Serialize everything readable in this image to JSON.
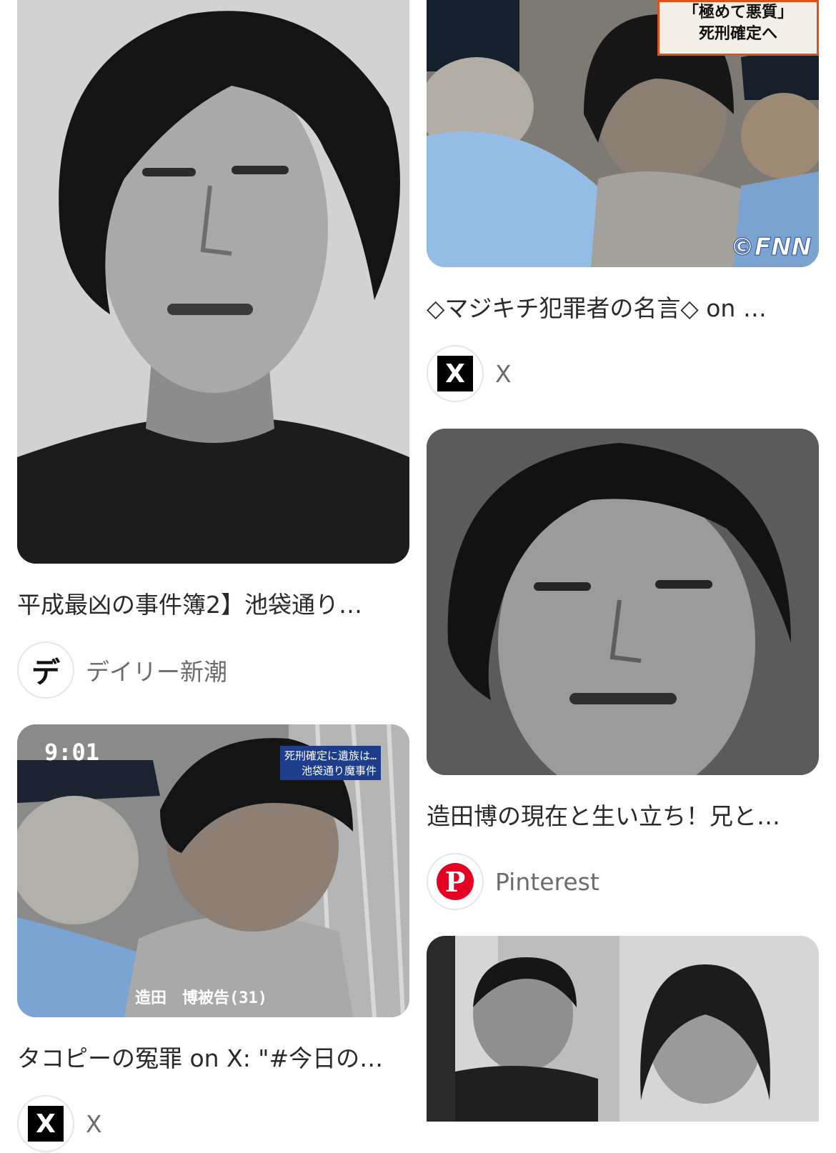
{
  "results": [
    {
      "title": "平成最凶の事件簿2】池袋通り…",
      "source": "デイリー新潮",
      "favicon_text": "デ"
    },
    {
      "title": "タコピーの冤罪 on X: \"#今日の…",
      "source": "X",
      "clock": "9:01",
      "caption1": "死刑確定に遺族は…",
      "caption2": "池袋通り魔事件",
      "nameplate": "造田　博被告(31)"
    },
    {
      "title": "◇マジキチ犯罪者の名言◇ on …",
      "source": "X",
      "headline1": "「極めて悪質」",
      "headline2": "死刑確定へ",
      "watermark": "©FNN"
    },
    {
      "title": "造田博の現在と生い立ち！兄と…",
      "source": "Pinterest"
    },
    {
      "title": "",
      "source": ""
    }
  ],
  "colors": {
    "pinterest": "#e60023",
    "x_black": "#000000",
    "devil_red": "#e0321e"
  },
  "icons": {
    "devil": "devil-favicon",
    "x": "x-logo-icon",
    "pinterest": "pinterest-icon"
  }
}
